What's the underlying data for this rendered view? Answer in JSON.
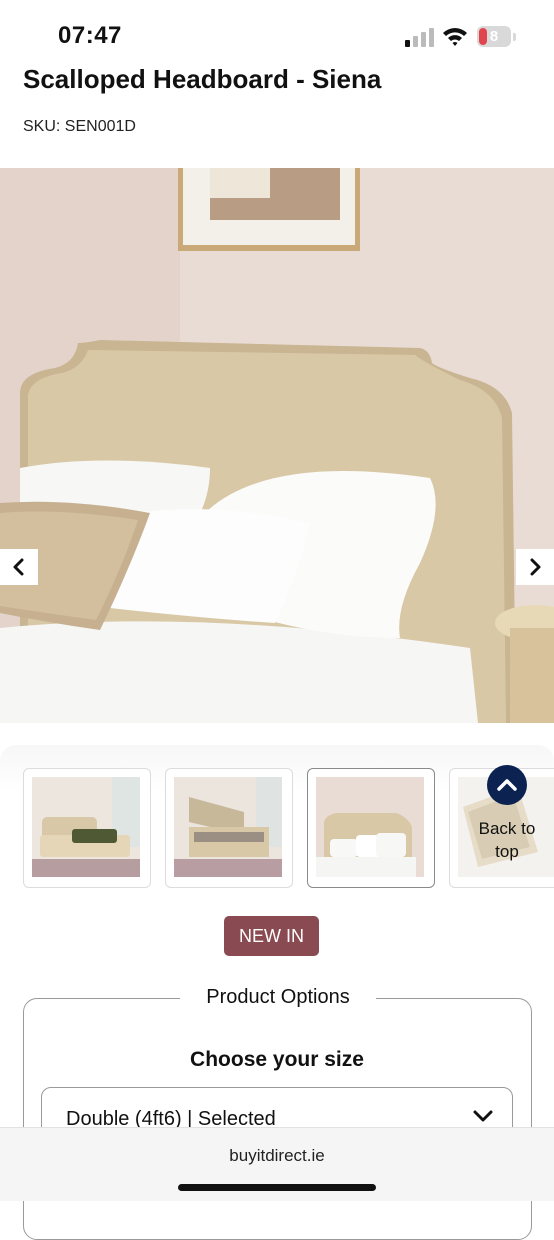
{
  "status_bar": {
    "time": "07:47",
    "battery_level": "8",
    "icons": [
      "signal-icon",
      "wifi-icon",
      "battery-icon"
    ]
  },
  "product": {
    "title": "Scalloped Headboard - Siena",
    "sku": "SKU: SEN001D",
    "badge": "NEW IN"
  },
  "gallery": {
    "prev_icon": "chevron-left-icon",
    "next_icon": "chevron-right-icon",
    "thumbnails": [
      "bed-room-thumbnail",
      "ottoman-open-thumbnail",
      "headboard-thumbnail",
      "headboard-detail-thumbnail"
    ],
    "active_index": 2
  },
  "back_to_top": {
    "label": "Back to top",
    "icon": "chevron-up-icon"
  },
  "options": {
    "legend": "Product Options",
    "size_heading": "Choose your size",
    "selected_size": "Double (4ft6) | Selected"
  },
  "browser": {
    "url": "buyitdirect.ie"
  },
  "colors": {
    "badge": "#8a4a52",
    "back_to_top": "#0c2352",
    "headboard": "#d8c7a6",
    "wall": "#e8dad3"
  }
}
